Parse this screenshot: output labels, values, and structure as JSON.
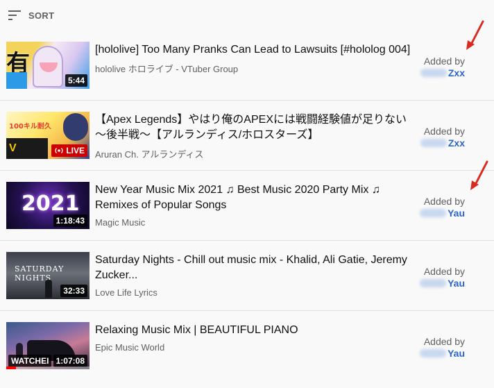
{
  "header": {
    "sort_label": "SORT"
  },
  "added_by_label": "Added by",
  "colors": {
    "accent_red": "#d92b1f",
    "link_blue": "#2a65c8",
    "live_red": "#cc0000"
  },
  "videos": [
    {
      "title": "[hololive] Too Many Pranks Can Lead to Lawsuits [#hololog 004]",
      "channel": "hololive ホロライブ - VTuber Group",
      "duration": "5:44",
      "added_by": "Zxx",
      "thumb_text": "有 罪"
    },
    {
      "title": "【Apex Legends】やはり俺のAPEXには戦闘経験値が足りない～後半戦～【アルランディス/ホロスターズ】",
      "channel": "Aruran Ch. アルランディス",
      "duration": "LIVE",
      "added_by": "Zxx",
      "thumb_text": "100キル耐久"
    },
    {
      "title": "New Year Music Mix 2021 ♫ Best Music 2020 Party Mix ♫ Remixes of Popular Songs",
      "channel": "Magic Music",
      "duration": "1:18:43",
      "added_by": "Yau",
      "thumb_text": "2021"
    },
    {
      "title": "Saturday Nights - Chill out music mix - Khalid, Ali Gatie, Jeremy Zucker...",
      "channel": "Love Life Lyrics",
      "duration": "32:33",
      "added_by": "Yau",
      "thumb_text": "SATURDAY NIGHTS"
    },
    {
      "title": "Relaxing Music Mix | BEAUTIFUL PIANO",
      "channel": "Epic Music World",
      "duration": "1:07:08",
      "watched_label": "WATCHEI",
      "watch_progress": 0.12,
      "added_by": "Yau"
    }
  ]
}
